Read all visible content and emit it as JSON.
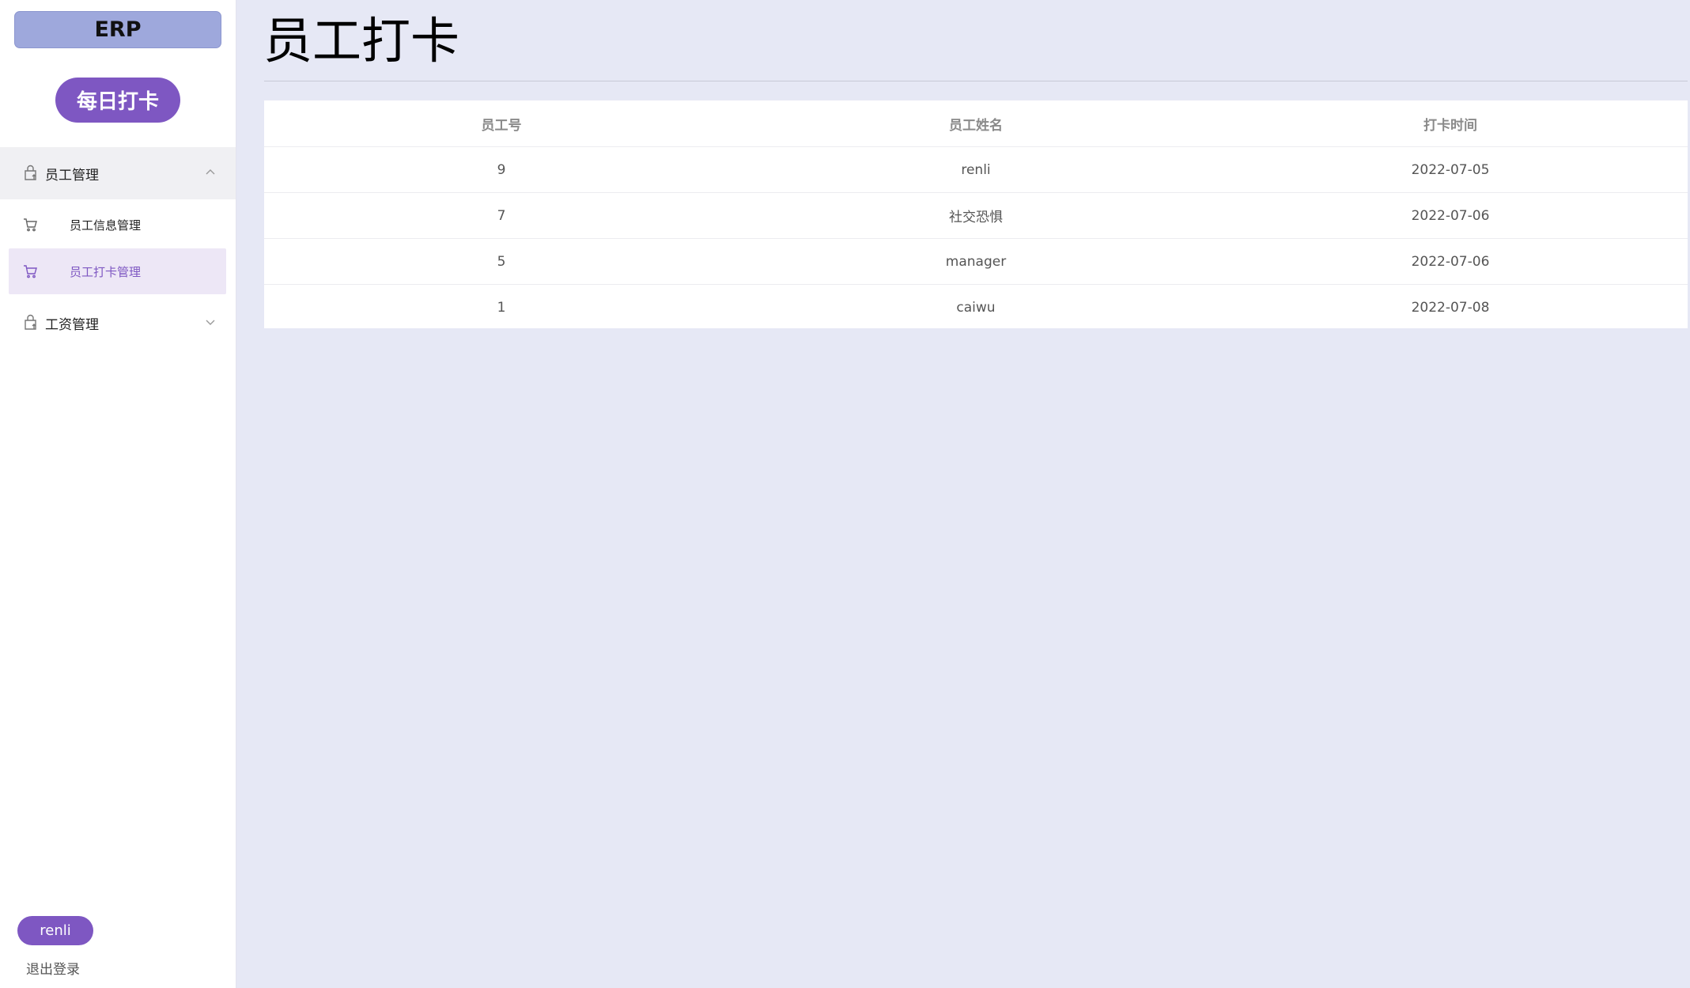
{
  "app": {
    "logo": "ERP"
  },
  "sidebar": {
    "checkin_button": "每日打卡",
    "groups": [
      {
        "label": "员工管理",
        "icon": "bag-icon",
        "expanded": true,
        "items": [
          {
            "label": "员工信息管理",
            "icon": "cart-icon",
            "active": false
          },
          {
            "label": "员工打卡管理",
            "icon": "cart-icon",
            "active": true
          }
        ]
      },
      {
        "label": "工资管理",
        "icon": "bag-icon",
        "expanded": false
      }
    ],
    "user": "renli",
    "logout": "退出登录"
  },
  "main": {
    "title": "员工打卡",
    "table": {
      "headers": [
        "员工号",
        "员工姓名",
        "打卡时间"
      ],
      "rows": [
        [
          "9",
          "renli",
          "2022-07-05"
        ],
        [
          "7",
          "社交恐惧",
          "2022-07-06"
        ],
        [
          "5",
          "manager",
          "2022-07-06"
        ],
        [
          "1",
          "caiwu",
          "2022-07-08"
        ]
      ]
    }
  },
  "colors": {
    "accent": "#7e57c2",
    "background": "#e6e8f5",
    "logo_bg": "#9ea8dc",
    "active_bg": "#ede7f6"
  }
}
